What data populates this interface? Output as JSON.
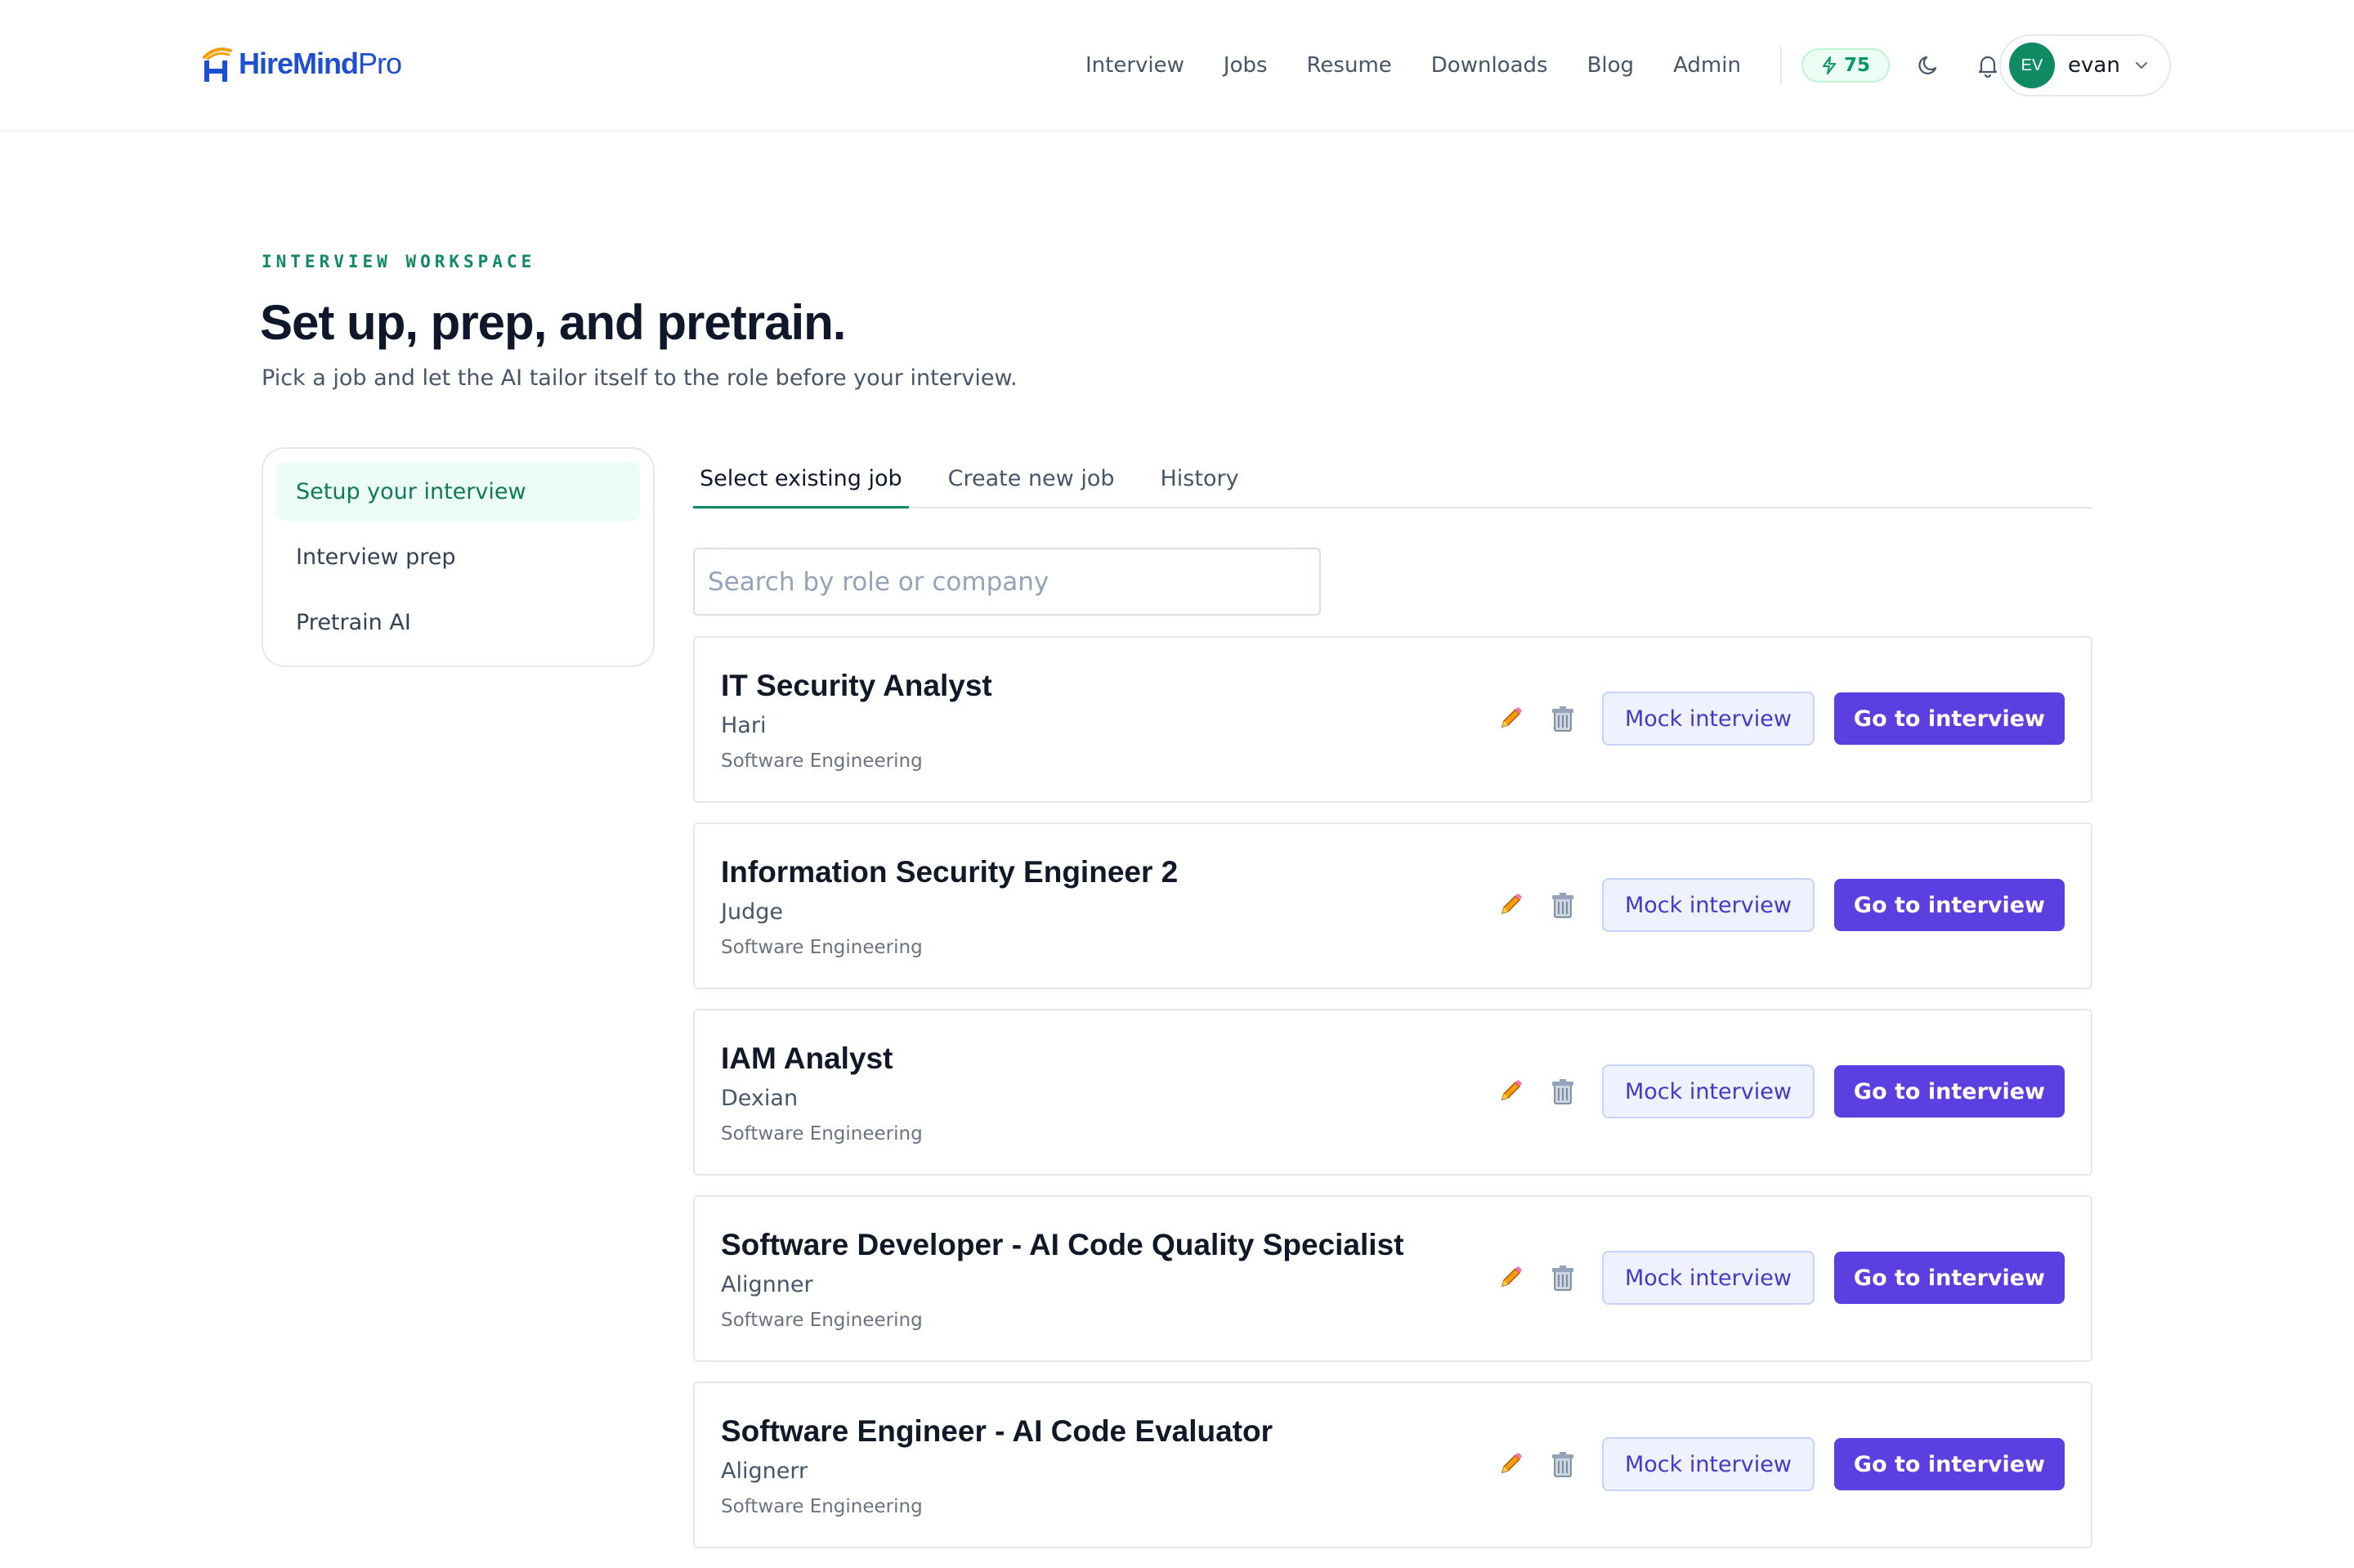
{
  "brand": {
    "name_main": "HireMind",
    "name_suffix": "Pro"
  },
  "nav": {
    "links": [
      "Interview",
      "Jobs",
      "Resume",
      "Downloads",
      "Blog",
      "Admin"
    ],
    "credits": "75"
  },
  "user": {
    "initials": "EV",
    "name": "evan"
  },
  "hero": {
    "eyebrow": "INTERVIEW WORKSPACE",
    "title": "Set up, prep, and pretrain.",
    "subtitle": "Pick a job and let the AI tailor itself to the role before your interview."
  },
  "steps": [
    {
      "label": "Setup your interview",
      "active": true
    },
    {
      "label": "Interview prep",
      "active": false
    },
    {
      "label": "Pretrain AI",
      "active": false
    }
  ],
  "tabs": [
    {
      "label": "Select existing job",
      "active": true
    },
    {
      "label": "Create new job",
      "active": false
    },
    {
      "label": "History",
      "active": false
    }
  ],
  "search": {
    "placeholder": "Search by role or company",
    "value": ""
  },
  "job_actions": {
    "mock_label": "Mock interview",
    "go_label": "Go to interview"
  },
  "jobs": [
    {
      "title": "IT Security Analyst",
      "company": "Hari",
      "category": "Software Engineering"
    },
    {
      "title": "Information Security Engineer 2",
      "company": "Judge",
      "category": "Software Engineering"
    },
    {
      "title": "IAM Analyst",
      "company": "Dexian",
      "category": "Software Engineering"
    },
    {
      "title": "Software Developer - AI Code Quality Specialist",
      "company": "Alignner",
      "category": "Software Engineering"
    },
    {
      "title": "Software Engineer - AI Code Evaluator",
      "company": "Alignerr",
      "category": "Software Engineering"
    }
  ],
  "colors": {
    "brand_blue": "#1e4fd0",
    "accent_green": "#0f8a63",
    "primary_purple": "#5b3fe0"
  },
  "icons": {
    "bolt": "bolt-icon",
    "moon": "moon-icon",
    "bell": "bell-icon",
    "chevron": "chevron-down-icon",
    "edit": "pencil-icon",
    "delete": "trash-icon"
  }
}
